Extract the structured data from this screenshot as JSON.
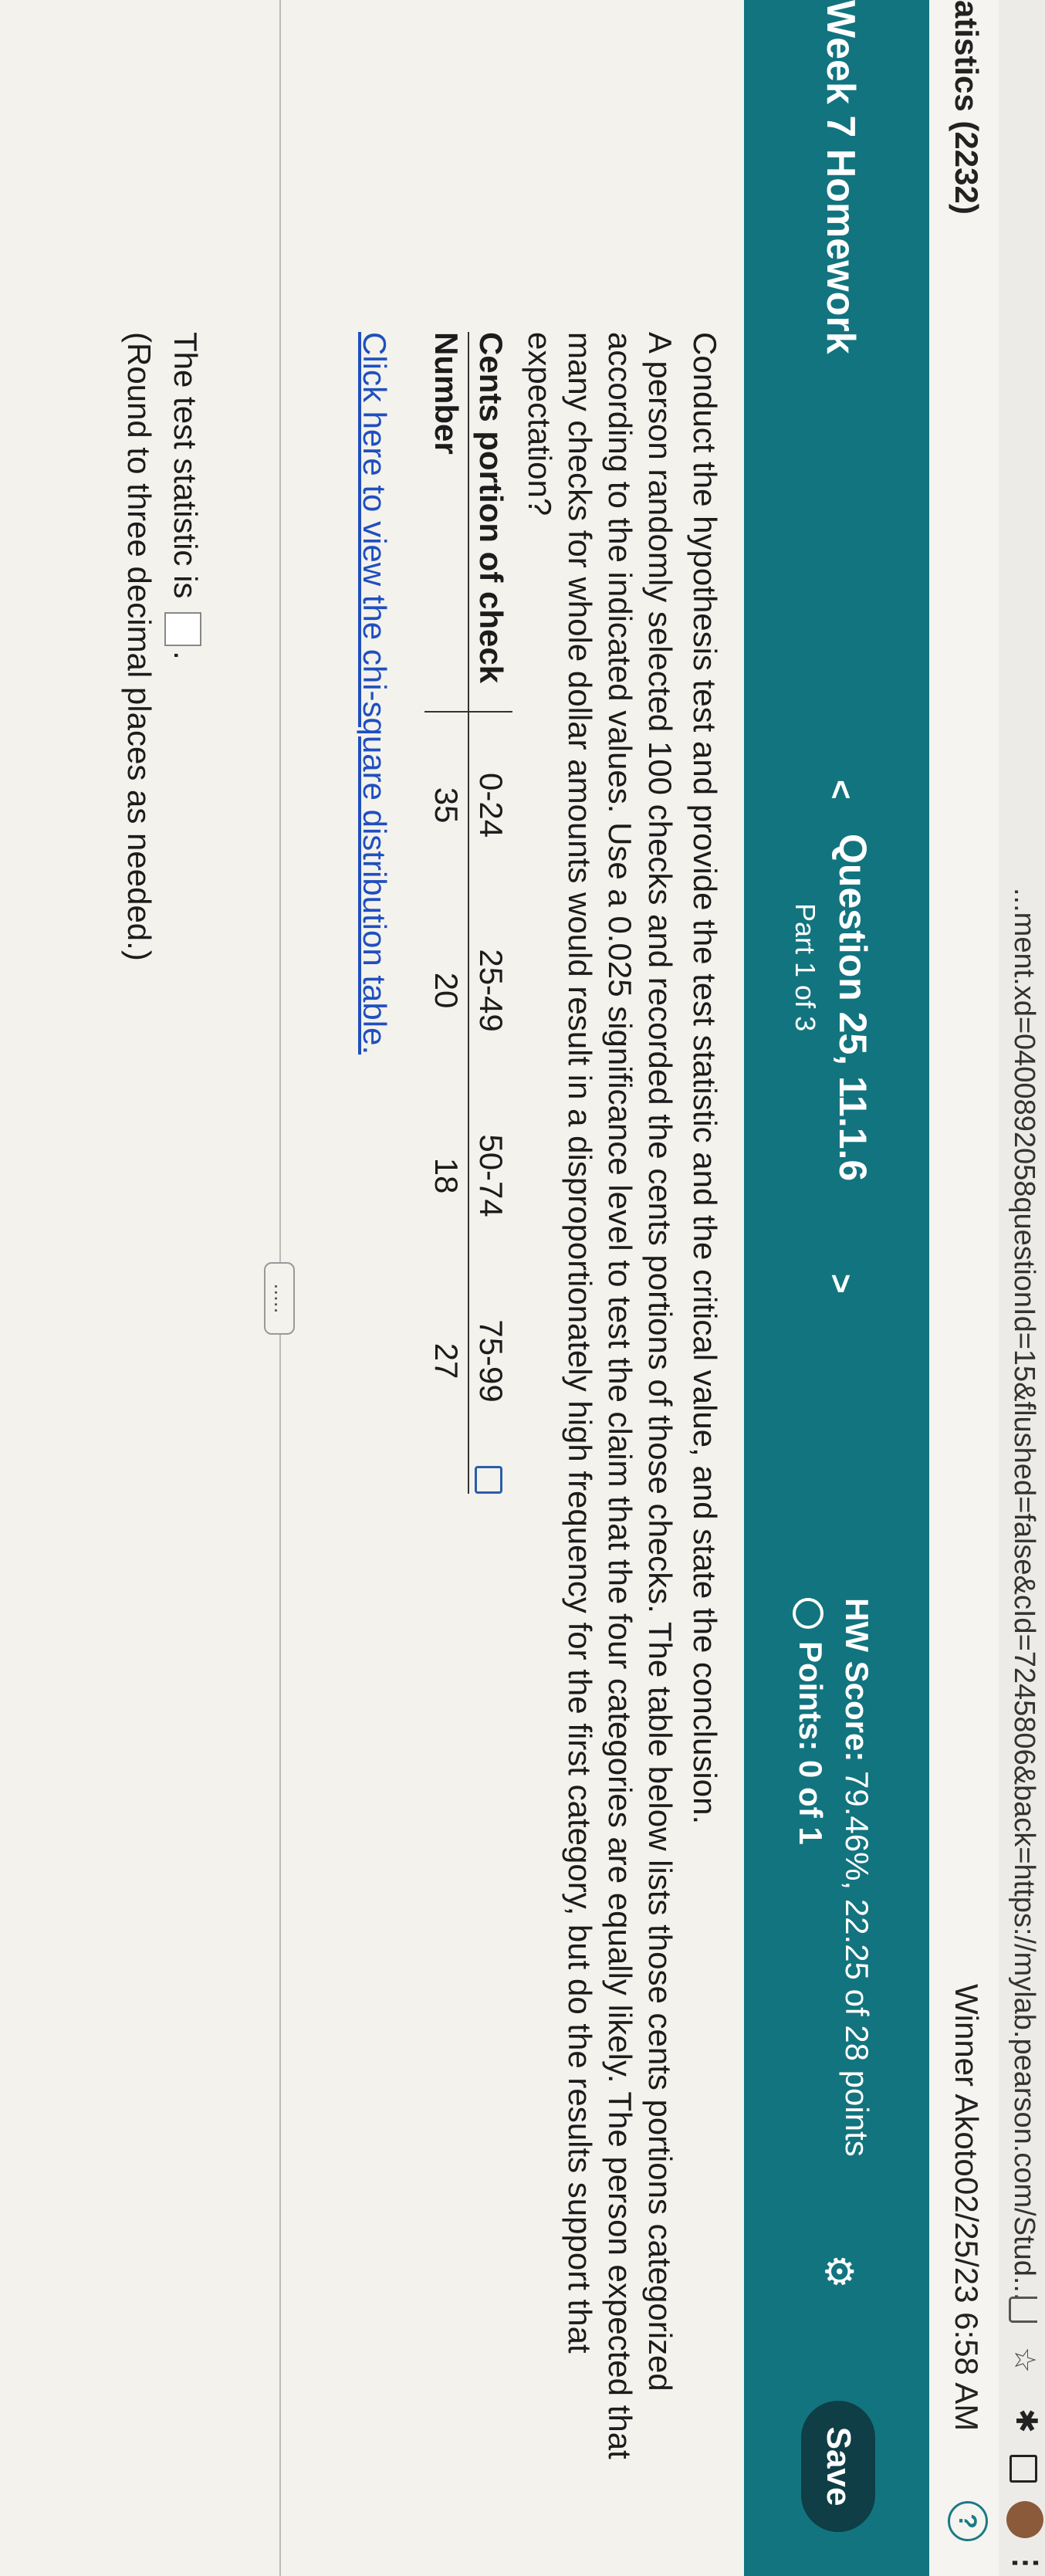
{
  "browser": {
    "url": "...ment.xd=0400892058questionId=15&flushed=false&cId=7245806&back=https://mylab.pearson.com/Stud..."
  },
  "course": {
    "title": "atistics (2232)",
    "user": "Winner Akoto",
    "datetime": "02/25/23 6:58 AM",
    "help": "?"
  },
  "toolbar": {
    "hw_title": "Week 7 Homework",
    "question": "Question 25, 11.1.6",
    "part": "Part 1 of 3",
    "hw_score_label": "HW Score:",
    "hw_score_value": "79.46%, 22.25 of 28 points",
    "points": "Points: 0 of 1",
    "save_label": "Save",
    "prev": "<",
    "next": ">"
  },
  "question": {
    "intro": "Conduct the hypothesis test and provide the test statistic and the critical value, and state the conclusion.",
    "body": "A person randomly selected 100 checks and recorded the cents portions of those checks. The table below lists those cents portions categorized according to the indicated values. Use a 0.025 significance level to test the claim that the four categories are equally likely. The person expected that many checks for whole dollar amounts would result in a disproportionately high frequency for the first category, but do the results support that expectation?",
    "table": {
      "header_label": "Cents portion of check",
      "row_label": "Number",
      "categories": [
        "0-24",
        "25-49",
        "50-74",
        "75-99"
      ],
      "values": [
        "35",
        "20",
        "18",
        "27"
      ]
    },
    "link": "Click here to view the chi-square distribution table.",
    "answer_prefix": "The test statistic is",
    "answer_suffix": ".",
    "round_note": "(Round to three decimal places as needed.)",
    "more": "....."
  }
}
